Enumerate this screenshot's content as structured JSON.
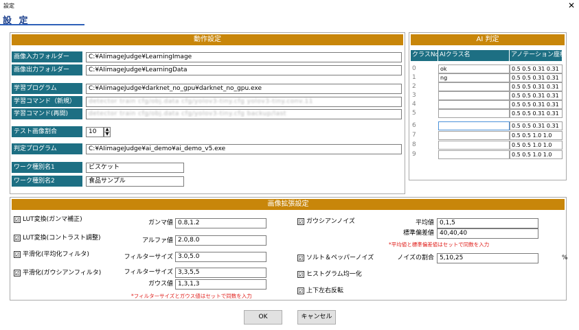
{
  "window": {
    "title": "設定",
    "close": "✕"
  },
  "header": {
    "title": "設 定"
  },
  "operation": {
    "title": "動作設定",
    "rows": [
      {
        "label": "画像入力フォルダー",
        "value": "C:¥AIimageJudge¥LearningImage"
      },
      {
        "label": "画像出力フォルダー",
        "value": "C:¥AIimageJudge¥LearningData"
      },
      {
        "label": "学習プログラム",
        "value": "C:¥AIimageJudge¥darknet_no_gpu¥darknet_no_gpu.exe"
      },
      {
        "label": "学習コマンド（新規）",
        "value": "detector train cfg/obj.data cfg/yolov3-tiny.cfg yolov3-tiny.conv.11"
      },
      {
        "label": "学習コマンド(再開)",
        "value": "detector train cfg/obj.data cfg/yolov3-tiny.cfg backup/last"
      },
      {
        "label": "テスト画像割合",
        "value": "10"
      },
      {
        "label": "判定プログラム",
        "value": "C:¥AIimageJudge¥ai_demo¥ai_demo_v5.exe"
      },
      {
        "label": "ワーク種別名1",
        "value": "ビスケット"
      },
      {
        "label": "ワーク種別名2",
        "value": "食品サンプル"
      }
    ]
  },
  "ai": {
    "title": "AI 判定",
    "headers": [
      "クラスNo",
      "AIクラス名",
      "アノテーション座標"
    ],
    "rows": [
      {
        "no": "0",
        "name": "ok",
        "coord": "0.5 0.5 0.31 0.31"
      },
      {
        "no": "1",
        "name": "ng",
        "coord": "0.5 0.5 0.31 0.31"
      },
      {
        "no": "2",
        "name": "",
        "coord": "0.5 0.5 0.31 0.31"
      },
      {
        "no": "3",
        "name": "",
        "coord": "0.5 0.5 0.31 0.31"
      },
      {
        "no": "4",
        "name": "",
        "coord": "0.5 0.5 0.31 0.31"
      },
      {
        "no": "5",
        "name": "",
        "coord": "0.5 0.5 0.31 0.31"
      },
      {
        "no": "6",
        "name": "",
        "coord": "0.5 0.5 0.31 0.31"
      },
      {
        "no": "7",
        "name": "",
        "coord": "0.5 0.5 1.0 1.0"
      },
      {
        "no": "8",
        "name": "",
        "coord": "0.5 0.5 1.0 1.0"
      },
      {
        "no": "9",
        "name": "",
        "coord": "0.5 0.5 1.0 1.0"
      }
    ]
  },
  "augment": {
    "title": "画像拡張設定",
    "lut_gamma": {
      "label": "LUT変換(ガンマ補正)",
      "param_label": "ガンマ値",
      "value": "0.8,1.2"
    },
    "lut_contrast": {
      "label": "LUT変換(コントラスト調整)",
      "param_label": "アルファ値",
      "value": "2.0,8.0"
    },
    "smooth_avg": {
      "label": "平滑化(平均化フィルタ)",
      "param_label": "フィルターサイズ",
      "value": "3.0,5.0"
    },
    "smooth_gauss": {
      "label": "平滑化(ガウシアンフィルタ)",
      "param_label": "フィルターサイズ",
      "value": "3,3,5,5",
      "param2_label": "ガウス値",
      "value2": "1,3,1,3"
    },
    "gauss_note": "*フィルターサイズとガウス値はセットで同数を入力",
    "gaussian_noise": {
      "label": "ガウシアンノイズ",
      "mean_label": "平均値",
      "mean_value": "0,1,5",
      "std_label": "標準偏差値",
      "std_value": "40,40,40",
      "note": "*平均値と標準偏差値はセットで同数を入力"
    },
    "salt_pepper": {
      "label": "ソルト＆ペッパーノイズ",
      "ratio_label": "ノイズの割合",
      "ratio_value": "5,10,25",
      "unit": "%"
    },
    "histogram": {
      "label": "ヒストグラム均一化"
    },
    "flip": {
      "label": "上下左右反転"
    },
    "check": "☑"
  },
  "buttons": {
    "ok": "OK",
    "cancel": "キャンセル"
  }
}
